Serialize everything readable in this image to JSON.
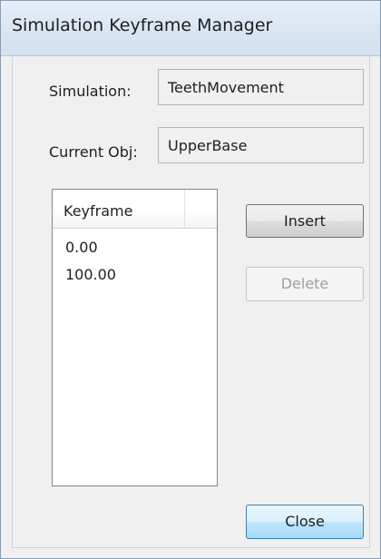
{
  "window": {
    "title": "Simulation Keyframe Manager"
  },
  "form": {
    "simulation_label": "Simulation:",
    "simulation_value": "TeethMovement",
    "current_obj_label": "Current Obj:",
    "current_obj_value": "UpperBase"
  },
  "keyframe_list": {
    "column_header": "Keyframe",
    "rows": [
      "0.00",
      "100.00"
    ]
  },
  "buttons": {
    "insert": "Insert",
    "delete": "Delete",
    "close": "Close"
  }
}
